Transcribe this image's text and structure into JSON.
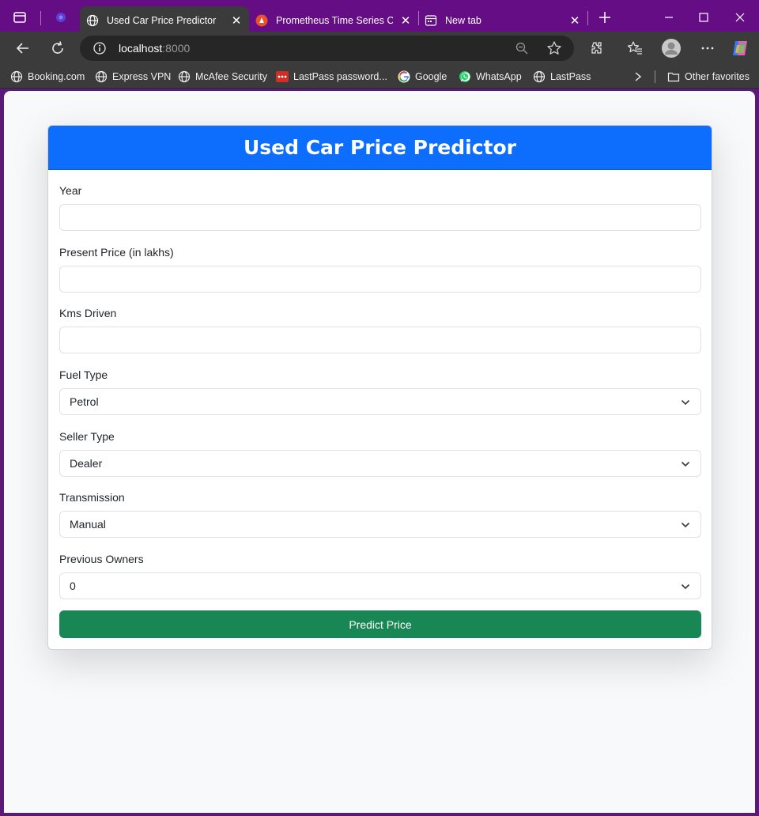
{
  "browser": {
    "tabs": [
      {
        "title": "Used Car Price Predictor",
        "favicon": "globe-icon",
        "active": true
      },
      {
        "title": "Prometheus Time Series Colle",
        "favicon": "prometheus-icon",
        "active": false
      },
      {
        "title": "New tab",
        "favicon": "new-tab-icon",
        "active": false
      }
    ],
    "url_host": "localhost",
    "url_port": ":8000",
    "bookmarks": [
      {
        "label": "Booking.com",
        "icon": "globe-icon"
      },
      {
        "label": "Express VPN",
        "icon": "globe-icon"
      },
      {
        "label": "McAfee Security",
        "icon": "globe-icon"
      },
      {
        "label": "LastPass password...",
        "icon": "lastpass-icon"
      },
      {
        "label": "Google",
        "icon": "google-icon"
      },
      {
        "label": "WhatsApp",
        "icon": "whatsapp-icon"
      },
      {
        "label": "LastPass",
        "icon": "globe-icon"
      }
    ],
    "other_favorites": "Other favorites",
    "colors": {
      "tabstrip": "#650d85",
      "toolbar": "#3b3b3b"
    }
  },
  "page": {
    "title": "Used Car Price Predictor",
    "fields": [
      {
        "label": "Year",
        "type": "input",
        "value": ""
      },
      {
        "label": "Present Price (in lakhs)",
        "type": "input",
        "value": ""
      },
      {
        "label": "Kms Driven",
        "type": "input",
        "value": ""
      },
      {
        "label": "Fuel Type",
        "type": "select",
        "value": "Petrol"
      },
      {
        "label": "Seller Type",
        "type": "select",
        "value": "Dealer"
      },
      {
        "label": "Transmission",
        "type": "select",
        "value": "Manual"
      },
      {
        "label": "Previous Owners",
        "type": "select",
        "value": "0"
      }
    ],
    "submit_label": "Predict Price",
    "colors": {
      "header": "#0d6efd",
      "button": "#198754",
      "background": "#f8f9fa"
    }
  }
}
